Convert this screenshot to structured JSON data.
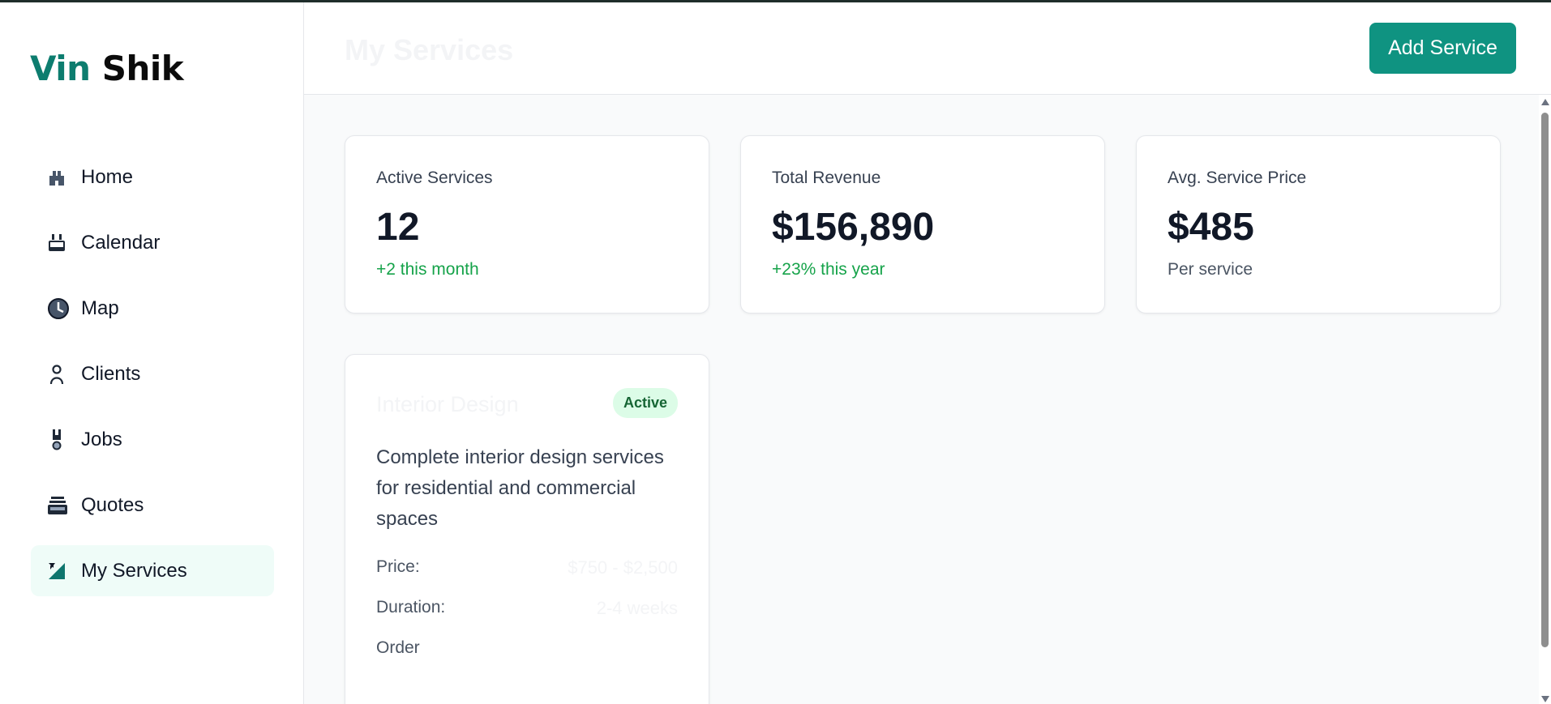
{
  "brand": {
    "part1": "Vin",
    "part2": "Shik"
  },
  "sidebar": {
    "items": [
      {
        "label": "Home",
        "icon": "home-icon"
      },
      {
        "label": "Calendar",
        "icon": "calendar-icon"
      },
      {
        "label": "Map",
        "icon": "clock-icon"
      },
      {
        "label": "Clients",
        "icon": "person-icon"
      },
      {
        "label": "Jobs",
        "icon": "wrench-icon"
      },
      {
        "label": "Quotes",
        "icon": "document-stack-icon"
      },
      {
        "label": "My Services",
        "icon": "services-icon",
        "active": true
      }
    ]
  },
  "header": {
    "title": "My Services",
    "add_button": "Add Service"
  },
  "stats": [
    {
      "title": "Active Services",
      "value": "12",
      "sub": "+2 this month"
    },
    {
      "title": "Total Revenue",
      "value": "$156,890",
      "sub": "+23% this year"
    },
    {
      "title": "Avg. Service Price",
      "value": "$485",
      "sub": "Per service"
    }
  ],
  "service_card": {
    "title": "Interior Design",
    "status": "Active",
    "description": "Complete interior design services for residential and commercial spaces",
    "price_label": "Price:",
    "price_value": "$750 - $2,500",
    "duration_label": "Duration:",
    "duration_value": "2-4 weeks",
    "order_label": "Order"
  },
  "colors": {
    "brand_teal": "#0d7d6f",
    "button": "#0f9381",
    "active_bg": "#effcf8",
    "positive": "#16a34a"
  }
}
